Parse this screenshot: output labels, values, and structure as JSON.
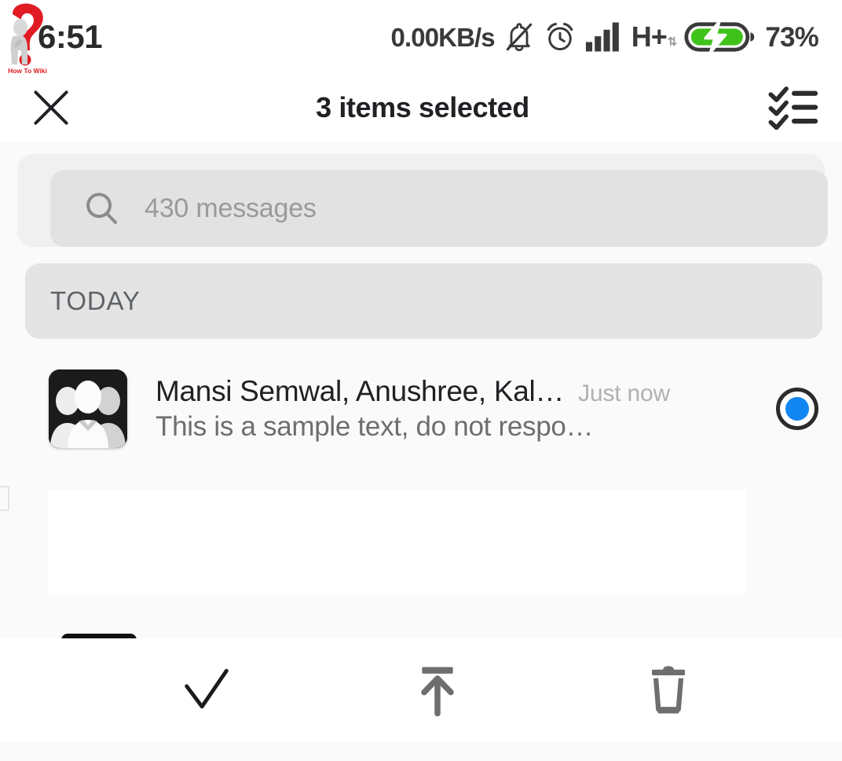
{
  "status_bar": {
    "time": "6:51",
    "network_speed": "0.00KB/s",
    "mute_icon": "bell-muted-icon",
    "alarm_icon": "alarm-clock-icon",
    "signal_icon": "cellular-signal-icon",
    "network_type": "H+",
    "data_arrows_icon": "data-transfer-arrows-icon",
    "battery_icon": "battery-charging-icon",
    "battery_percent": "73%",
    "battery_color": "#3fc219",
    "watermark_text": "How To Wiki",
    "watermark_icon": "question-mark-person-logo"
  },
  "app_bar": {
    "close_icon": "close-x-icon",
    "title": "3 items selected",
    "select_all_icon": "select-all-checklist-icon"
  },
  "search": {
    "icon": "search-icon",
    "placeholder": "430 messages"
  },
  "section": {
    "label": "TODAY"
  },
  "conversation": {
    "avatar_icon": "group-avatar-icon",
    "title": "Mansi Semwal, Anushree, Kal…",
    "timestamp": "Just now",
    "snippet": "This is a sample text, do not respo…",
    "selected": true,
    "selection_icon": "radio-selected-icon",
    "selection_color": "#1186f0"
  },
  "overlay": {
    "fab_icon": "empty-fab-placeholder",
    "peek_chip": "hidden-chip-placeholder"
  },
  "bottom_bar": {
    "actions": [
      {
        "name": "mark-read-button",
        "icon": "checkmark-icon",
        "color": "#1b1b1b"
      },
      {
        "name": "archive-button",
        "icon": "archive-up-arrow-icon",
        "color": "#6e6e6e"
      },
      {
        "name": "delete-button",
        "icon": "trash-can-icon",
        "color": "#6e6e6e"
      }
    ]
  }
}
